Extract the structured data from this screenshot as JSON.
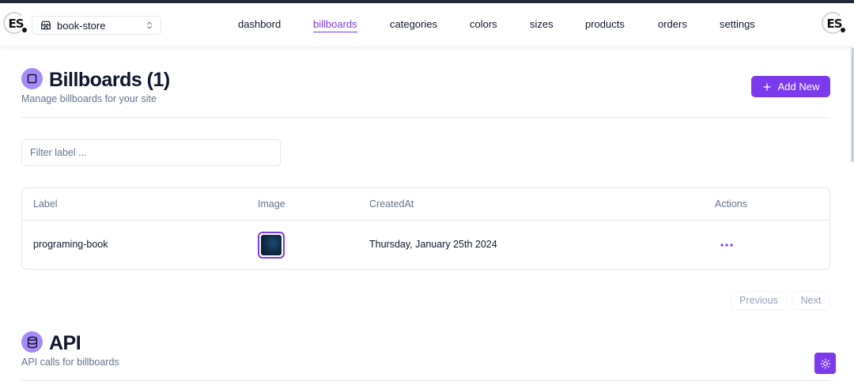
{
  "header": {
    "logo_text": "ES",
    "store_switcher": {
      "selected": "book-store"
    },
    "nav": [
      {
        "label": "dashbord",
        "active": false
      },
      {
        "label": "billboards",
        "active": true
      },
      {
        "label": "categories",
        "active": false
      },
      {
        "label": "colors",
        "active": false
      },
      {
        "label": "sizes",
        "active": false
      },
      {
        "label": "products",
        "active": false
      },
      {
        "label": "orders",
        "active": false
      },
      {
        "label": "settings",
        "active": false
      }
    ]
  },
  "billboards": {
    "title": "Billboards (1)",
    "subtitle": "Manage billboards for your site",
    "add_label": "Add New",
    "filter_placeholder": "Filter label ...",
    "columns": [
      "Label",
      "Image",
      "CreatedAt",
      "Actions"
    ],
    "rows": [
      {
        "label": "programing-book",
        "created_at": "Thursday, January 25th 2024"
      }
    ],
    "pagination": {
      "previous": "Previous",
      "next": "Next"
    }
  },
  "api": {
    "title": "API",
    "subtitle": "API calls for billboards"
  },
  "colors": {
    "accent": "#7c3aed",
    "badge": "#a78bfa"
  },
  "icons": {
    "store": "store-icon",
    "chevrons": "chevrons-up-down-icon",
    "billboard": "square-icon",
    "api": "database-icon",
    "add": "plus-icon",
    "actions": "more-horizontal-icon",
    "theme": "sun-icon"
  }
}
